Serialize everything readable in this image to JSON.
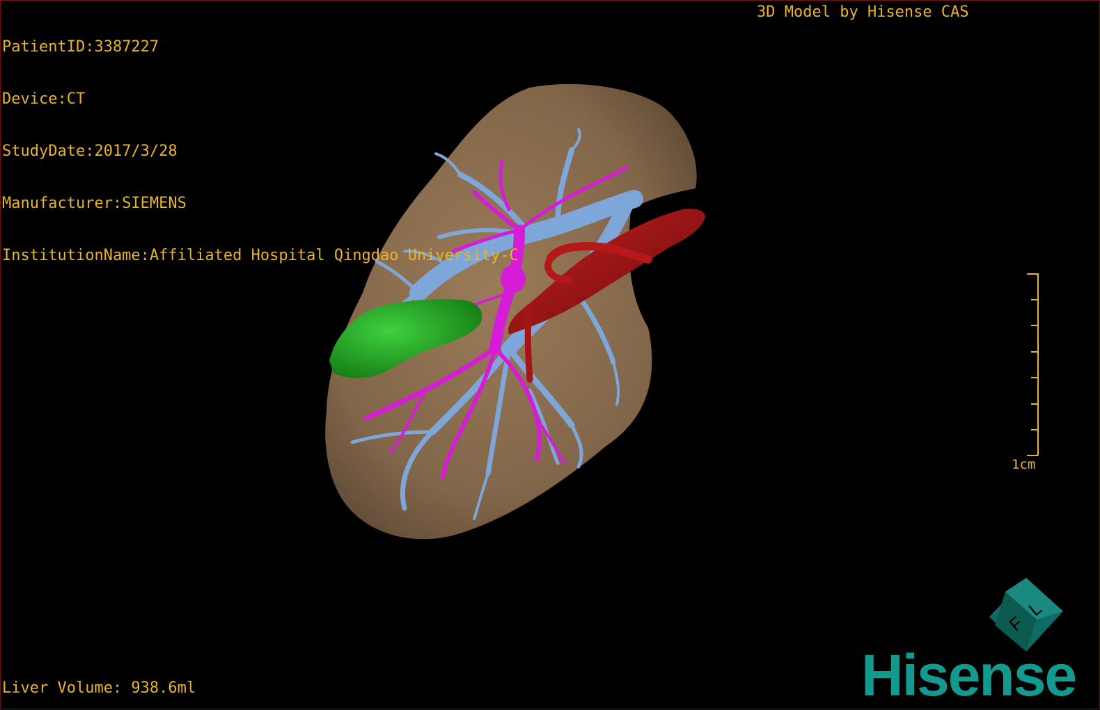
{
  "info": {
    "patient_id": "PatientID:3387227",
    "device": "Device:CT",
    "study_date": "StudyDate:2017/3/28",
    "manufacturer": "Manufacturer:SIEMENS",
    "institution": "InstitutionName:Affiliated Hospital Qingdao University-C"
  },
  "title": "3D Model by Hisense CAS",
  "volume": "Liver Volume: 938.6ml",
  "scale": {
    "label": "1cm"
  },
  "orientation_cube": {
    "label_f": "F",
    "label_l": "L"
  },
  "brand": "Hisense",
  "colors": {
    "text": "#e8b42a",
    "liver": "#8a6e4e",
    "portal_vein": "#7fa6d8",
    "hepatic_artery": "#d61cd6",
    "vena_cava": "#9a1212",
    "gallbladder": "#1fa51f",
    "brand": "#139a8e"
  }
}
